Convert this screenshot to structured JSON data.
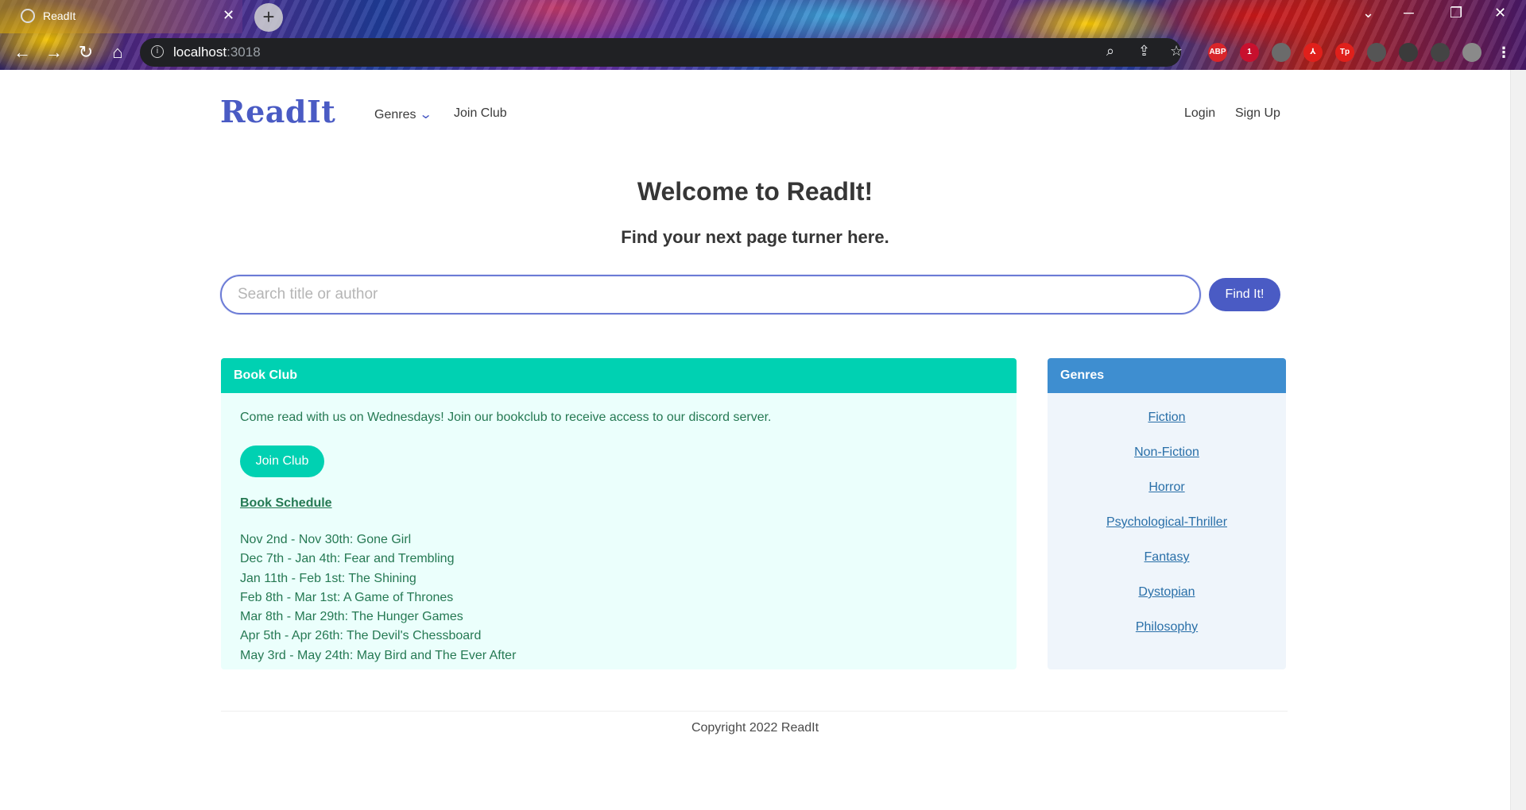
{
  "browser": {
    "tab_title": "ReadIt",
    "tab_close": "✕",
    "new_tab": "+",
    "url_host": "localhost",
    "url_port": ":3018",
    "extensions": [
      "ABP",
      "1",
      "Tp"
    ]
  },
  "header": {
    "brand": "ReadIt",
    "nav": {
      "genres": "Genres",
      "join_club": "Join Club"
    },
    "auth": {
      "login": "Login",
      "signup": "Sign Up"
    }
  },
  "hero": {
    "title": "Welcome to ReadIt!",
    "subtitle": "Find your next page turner here."
  },
  "search": {
    "placeholder": "Search title or author",
    "button": "Find It!"
  },
  "book_club": {
    "heading": "Book Club",
    "description": "Come read with us on Wednesdays! Join our bookclub to receive access to our discord server.",
    "join_button": "Join Club",
    "schedule_link": "Book Schedule",
    "schedule": [
      "Nov 2nd - Nov 30th: Gone Girl",
      "Dec 7th - Jan 4th: Fear and Trembling",
      "Jan 11th - Feb 1st: The Shining",
      "Feb 8th - Mar 1st: A Game of Thrones",
      "Mar 8th - Mar 29th: The Hunger Games",
      "Apr 5th - Apr 26th: The Devil's Chessboard",
      "May 3rd - May 24th: May Bird and The Ever After"
    ]
  },
  "genres": {
    "heading": "Genres",
    "items": [
      "Fiction",
      "Non-Fiction",
      "Horror",
      "Psychological-Thriller",
      "Fantasy",
      "Dystopian",
      "Philosophy"
    ]
  },
  "footer": {
    "copyright": "Copyright 2022 ReadIt"
  },
  "colors": {
    "brand": "#4a5bc4",
    "club_header": "#00d1b2",
    "club_bg": "#ebfffc",
    "genre_header": "#3e8ed0",
    "genre_bg": "#eff5fb"
  }
}
